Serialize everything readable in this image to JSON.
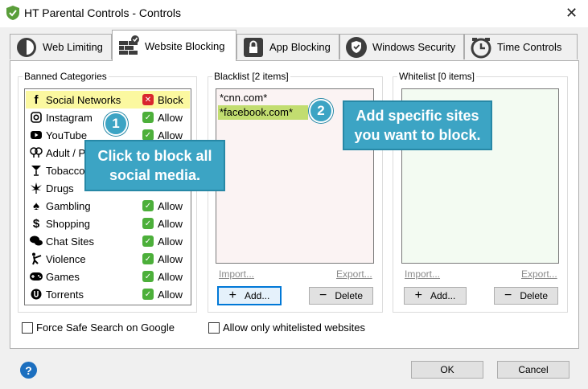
{
  "window": {
    "title": "HT Parental Controls - Controls",
    "close_glyph": "✕"
  },
  "tabs": [
    {
      "label": "Web Limiting",
      "icon": "clock-half-icon"
    },
    {
      "label": "Website Blocking",
      "icon": "brick-wall-icon",
      "active": true
    },
    {
      "label": "App Blocking",
      "icon": "lock-icon"
    },
    {
      "label": "Windows Security",
      "icon": "shield-check-icon"
    },
    {
      "label": "Time Controls",
      "icon": "clock-icon"
    }
  ],
  "banned": {
    "title": "Banned Categories",
    "items": [
      {
        "name": "Social Networks",
        "icon": "facebook-f-icon",
        "status": "Block",
        "selected": true
      },
      {
        "name": "Instagram",
        "icon": "instagram-icon",
        "status": "Allow"
      },
      {
        "name": "YouTube",
        "icon": "youtube-icon",
        "status": "Allow"
      },
      {
        "name": "Adult / P",
        "icon": "adult-icon",
        "status": ""
      },
      {
        "name": "Tobacco",
        "icon": "cocktail-icon",
        "status": ""
      },
      {
        "name": "Drugs",
        "icon": "leaf-icon",
        "status": ""
      },
      {
        "name": "Gambling",
        "icon": "spade-icon",
        "status": "Allow"
      },
      {
        "name": "Shopping",
        "icon": "dollar-icon",
        "status": "Allow"
      },
      {
        "name": "Chat Sites",
        "icon": "chat-icon",
        "status": "Allow"
      },
      {
        "name": "Violence",
        "icon": "kick-icon",
        "status": "Allow"
      },
      {
        "name": "Games",
        "icon": "gamepad-icon",
        "status": "Allow"
      },
      {
        "name": "Torrents",
        "icon": "torrent-icon",
        "status": "Allow"
      }
    ]
  },
  "blacklist": {
    "title": "Blacklist [2 items]",
    "items": [
      "*cnn.com*",
      "*facebook.com*"
    ],
    "import_label": "Import...",
    "export_label": "Export...",
    "add_label": "Add...",
    "delete_label": "Delete"
  },
  "whitelist": {
    "title": "Whitelist [0 items]",
    "items": [],
    "import_label": "Import...",
    "export_label": "Export...",
    "add_label": "Add...",
    "delete_label": "Delete"
  },
  "options": {
    "safe_search": "Force Safe Search on Google",
    "whitelist_only": "Allow only whitelisted websites"
  },
  "footer": {
    "help": "?",
    "ok": "OK",
    "cancel": "Cancel"
  },
  "callouts": {
    "one_number": "1",
    "one_text": "Click to block all social media.",
    "two_number": "2",
    "two_text": "Add specific sites you want to block."
  },
  "colors": {
    "callout": "#3ca4c4",
    "selected_category": "#fbf8a0",
    "selected_entry": "#c2dd70",
    "allow": "#4caf3a",
    "block": "#d9262e"
  }
}
